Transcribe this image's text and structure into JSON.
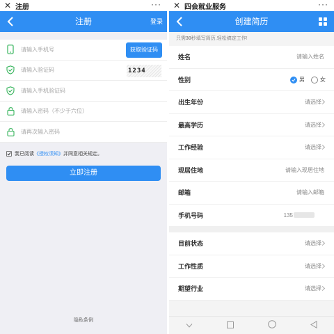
{
  "left": {
    "titlebar": {
      "close_icon": "close-icon",
      "title": "注册",
      "more": "···"
    },
    "nav": {
      "title": "注册",
      "login": "登录"
    },
    "fields": [
      {
        "placeholder": "请输入手机号",
        "icon": "phone-icon"
      },
      {
        "placeholder": "请输入验证码",
        "icon": "shield-check-icon"
      },
      {
        "placeholder": "请输入手机验证码",
        "icon": "shield-check-icon"
      },
      {
        "placeholder": "请输入密码（不少于六位）",
        "icon": "lock-icon"
      },
      {
        "placeholder": "请再次输入密码",
        "icon": "lock-icon"
      }
    ],
    "get_code": "获取验证码",
    "captcha": "1234",
    "agreement": {
      "prefix": "我已阅读",
      "link": "《授权须知》",
      "suffix": "并同意相关规定。"
    },
    "register_button": "立即注册",
    "privacy": "隐私条例"
  },
  "right": {
    "titlebar": {
      "close_icon": "close-icon",
      "title": "四会就业服务",
      "more": "···"
    },
    "nav": {
      "title": "创建简历",
      "menu_icon": "grid-menu-icon"
    },
    "notice": {
      "prefix": "只需",
      "bold": "30",
      "suffix": "秒填写简历,轻松搞定工作!"
    },
    "rows": [
      {
        "label": "姓名",
        "value": "请输入姓名"
      },
      {
        "label": "性别",
        "male": "男",
        "female": "女"
      },
      {
        "label": "出生年份",
        "value": "请选择"
      },
      {
        "label": "最高学历",
        "value": "请选择"
      },
      {
        "label": "工作经验",
        "value": "请选择"
      },
      {
        "label": "现居住地",
        "value": "请输入现居住地"
      },
      {
        "label": "邮箱",
        "value": "请输入邮箱"
      },
      {
        "label": "手机号码",
        "value": "135"
      }
    ],
    "rows2": [
      {
        "label": "目前状态",
        "value": "请选择"
      },
      {
        "label": "工作性质",
        "value": "请选择"
      },
      {
        "label": "期望行业",
        "value": "请选择"
      }
    ],
    "sysbar": [
      "nav-back-icon",
      "nav-recent-icon",
      "nav-home-icon",
      "nav-triangle-icon"
    ]
  }
}
